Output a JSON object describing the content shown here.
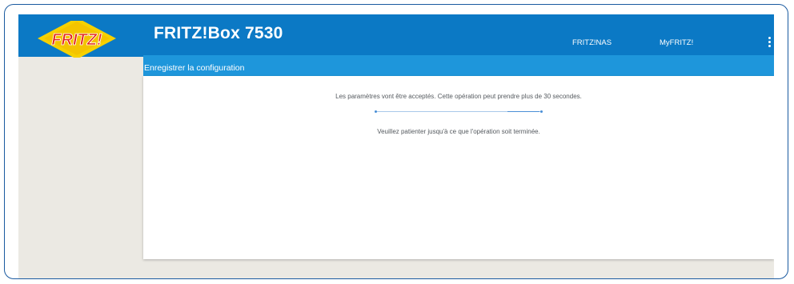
{
  "header": {
    "product_title": "FRITZ!Box 7530",
    "logo_text": "FRITZ!",
    "nav": [
      {
        "label": "FRITZ!NAS"
      },
      {
        "label": "MyFRITZ!"
      }
    ],
    "menu_icon": "kebab-menu-icon"
  },
  "subheader": {
    "title": "Enregistrer la configuration"
  },
  "main": {
    "message": "Les paramètres vont être acceptés. Cette opération peut prendre plus de 30 secondes.",
    "wait_message": "Veuillez patienter jusqu'à ce que l'opération soit terminée."
  },
  "colors": {
    "topbar": "#0b79c5",
    "subbar": "#1e96db",
    "background": "#ebe9e3",
    "logo_red": "#e2231a",
    "logo_yellow": "#f6d100"
  }
}
